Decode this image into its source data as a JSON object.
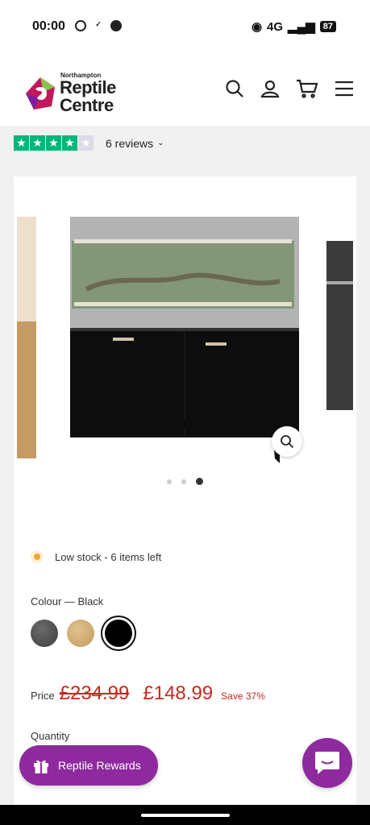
{
  "status": {
    "time": "00:00",
    "network": "4G",
    "battery": "87"
  },
  "header": {
    "logo_small": "Northampton",
    "logo_line1": "Reptile",
    "logo_line2": "Centre"
  },
  "reviews": {
    "label": "6 reviews",
    "rating": 4,
    "max": 5
  },
  "gallery": {
    "dots": 3,
    "active_index": 2
  },
  "stock": {
    "text": "Low stock - 6 items left"
  },
  "colour": {
    "label": "Colour — Black",
    "options": [
      "Grey",
      "Oak",
      "Black"
    ],
    "selected": "Black"
  },
  "price": {
    "label": "Price",
    "original": "£234.99",
    "sale": "£148.99",
    "save": "Save 37%"
  },
  "quantity": {
    "label": "Quantity"
  },
  "rewards": {
    "label": "Reptile Rewards"
  },
  "colors": {
    "brand_purple": "#8e2a9e",
    "sale_red": "#c8281e",
    "trustpilot_green": "#00b67a"
  }
}
